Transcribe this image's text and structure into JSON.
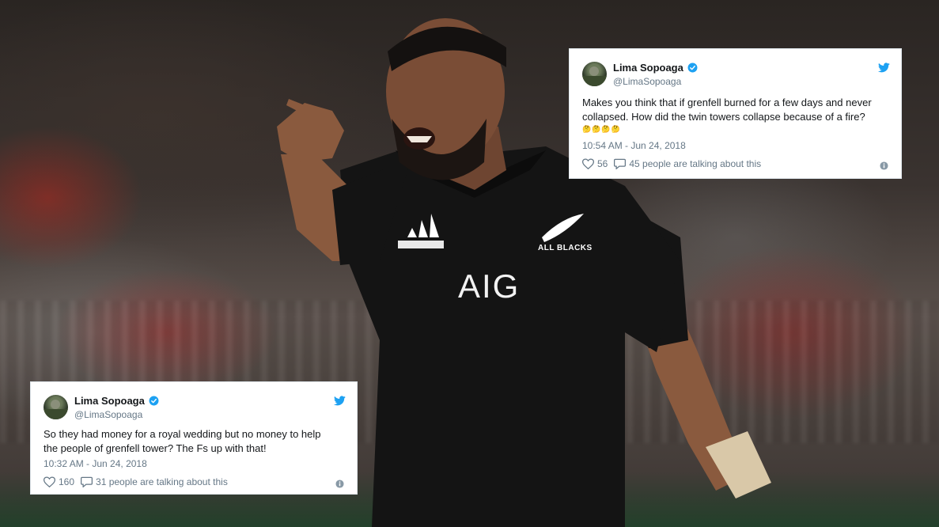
{
  "tweets": [
    {
      "name": "Lima Sopoaga",
      "handle": "@LimaSopoaga",
      "text_line1": "Makes you think that if grenfell burned for a few days and never",
      "text_line2": "collapsed. How did the twin towers collapse because of a fire?",
      "emoji_line": "🤔🤔🤔🤔",
      "timestamp": "10:54 AM - Jun 24, 2018",
      "likes": "56",
      "talking": "45 people are talking about this"
    },
    {
      "name": "Lima Sopoaga",
      "handle": "@LimaSopoaga",
      "text_line1": "So they had money for a royal wedding but no money to help",
      "text_line2": "the people of grenfell tower? The Fs up with that!",
      "timestamp": "10:32 AM - Jun 24, 2018",
      "likes": "160",
      "talking": "31 people are talking about this"
    }
  ],
  "jersey": {
    "sponsor": "AIG",
    "team": "ALL BLACKS"
  },
  "colors": {
    "verified": "#1da1f2",
    "twitter_blue": "#1da1f2",
    "muted": "#657786",
    "jersey": "#141414"
  },
  "icons": [
    "verified-badge-icon",
    "twitter-bird-icon",
    "heart-icon",
    "speech-bubble-icon",
    "info-icon",
    "fern-icon",
    "adidas-logo-icon"
  ]
}
